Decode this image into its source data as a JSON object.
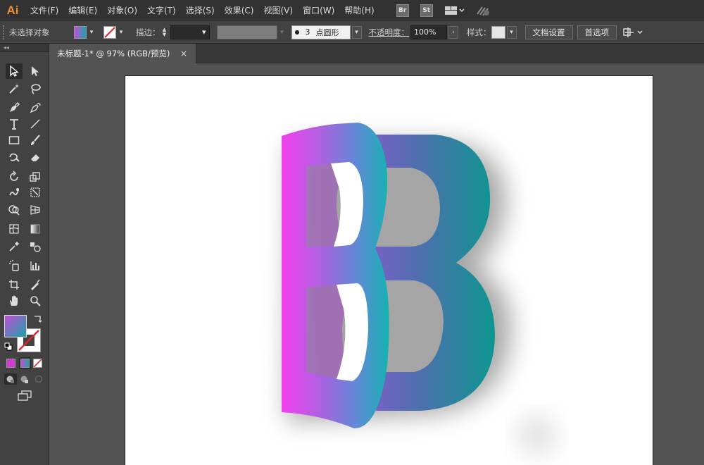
{
  "app": {
    "logo": "Ai"
  },
  "menu": [
    "文件(F)",
    "编辑(E)",
    "对象(O)",
    "文字(T)",
    "选择(S)",
    "效果(C)",
    "视图(V)",
    "窗口(W)",
    "帮助(H)"
  ],
  "menu_buttons": {
    "bridge": "Br",
    "stock": "St"
  },
  "options_bar": {
    "selection_status": "未选择对象",
    "stroke_label": "描边：",
    "brush_size": "3",
    "brush_label": "点圆形",
    "opacity_label": "不透明度：",
    "opacity_value": "100%",
    "style_label": "样式：",
    "doc_setup_button": "文档设置",
    "preferences_button": "首选项"
  },
  "document_tab": {
    "title": "未标题-1* @ 97% (RGB/预览)",
    "close": "×"
  },
  "toolbar": {
    "collapse": "◂◂"
  },
  "colors": {
    "fill_gradient_start": "#c24fd6",
    "fill_gradient_end": "#1aa3a8",
    "front_gradient_start": "#f23ff0",
    "front_gradient_end": "#14b3b0",
    "back_gradient_start": "#8a5bd0",
    "back_gradient_end": "#0d9690",
    "icon_color": "#dcdcdc"
  },
  "icons": [
    "selection-tool-icon",
    "direct-selection-tool-icon",
    "magic-wand-icon",
    "lasso-icon",
    "pen-icon",
    "curvature-icon",
    "type-icon",
    "line-icon",
    "rectangle-icon",
    "paintbrush-icon",
    "shaper-icon",
    "eraser-icon",
    "rotate-icon",
    "scale-icon",
    "warp-icon",
    "free-transform-icon",
    "shape-builder-icon",
    "perspective-grid-icon",
    "mesh-icon",
    "gradient-icon",
    "eyedropper-icon",
    "blend-icon",
    "symbol-sprayer-icon",
    "column-graph-icon",
    "artboard-tool-icon",
    "slice-icon",
    "hand-icon",
    "zoom-icon",
    "swap-icon",
    "default-colors-icon",
    "screen-mode-icon"
  ]
}
